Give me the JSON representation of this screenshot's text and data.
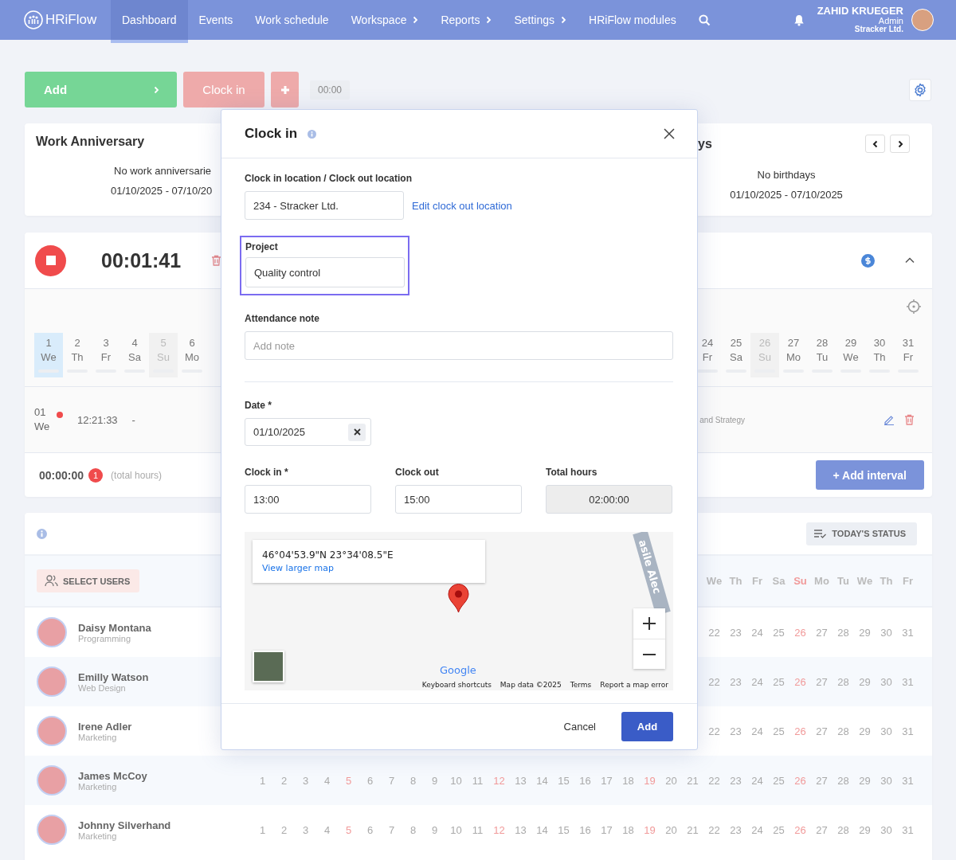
{
  "nav": {
    "brand": "HRiFlow",
    "items": [
      {
        "label": "Dashboard",
        "selected": true,
        "submenu": false
      },
      {
        "label": "Events",
        "selected": false,
        "submenu": false
      },
      {
        "label": "Work schedule",
        "selected": false,
        "submenu": false
      },
      {
        "label": "Workspace",
        "selected": false,
        "submenu": true
      },
      {
        "label": "Reports",
        "selected": false,
        "submenu": true
      },
      {
        "label": "Settings",
        "selected": false,
        "submenu": true
      },
      {
        "label": "HRiFlow modules",
        "selected": false,
        "submenu": false
      }
    ],
    "user": {
      "name": "ZAHID KRUEGER",
      "role": "Admin",
      "company": "Stracker Ltd."
    }
  },
  "actions": {
    "add": "Add",
    "clock_in": "Clock in",
    "timer": "00:00"
  },
  "anniversary": {
    "title": "Work Anniversary",
    "message": "No work anniversarie",
    "range": "01/10/2025 - 07/10/20"
  },
  "birthdays": {
    "title": "ys",
    "message": "No birthdays",
    "range": "01/10/2025 - 07/10/2025"
  },
  "tracker": {
    "elapsed": "00:01:41",
    "days_left": [
      {
        "day": "1",
        "weekday": "We",
        "selected": true,
        "weekend": false
      },
      {
        "day": "2",
        "weekday": "Th",
        "selected": false,
        "weekend": false
      },
      {
        "day": "3",
        "weekday": "Fr",
        "selected": false,
        "weekend": false
      },
      {
        "day": "4",
        "weekday": "Sa",
        "selected": false,
        "weekend": false
      },
      {
        "day": "5",
        "weekday": "Su",
        "selected": false,
        "weekend": true
      },
      {
        "day": "6",
        "weekday": "Mo",
        "selected": false,
        "weekend": false
      }
    ],
    "days_right": [
      {
        "day": "24",
        "weekday": "Fr",
        "selected": false,
        "weekend": false
      },
      {
        "day": "25",
        "weekday": "Sa",
        "selected": false,
        "weekend": false
      },
      {
        "day": "26",
        "weekday": "Su",
        "selected": false,
        "weekend": true
      },
      {
        "day": "27",
        "weekday": "Mo",
        "selected": false,
        "weekend": false
      },
      {
        "day": "28",
        "weekday": "Tu",
        "selected": false,
        "weekend": false
      },
      {
        "day": "29",
        "weekday": "We",
        "selected": false,
        "weekend": false
      },
      {
        "day": "30",
        "weekday": "Th",
        "selected": false,
        "weekend": false
      },
      {
        "day": "31",
        "weekday": "Fr",
        "selected": false,
        "weekend": false
      }
    ],
    "entry": {
      "day": "01",
      "weekday": "We",
      "start": "12:21:33",
      "end": "-",
      "project": "and Strategy"
    },
    "total": "00:00:00",
    "count": "1",
    "total_label": "(total hours)",
    "add_interval": "+ Add interval"
  },
  "schedule": {
    "today_status": "TODAY'S STATUS",
    "select_users": "SELECT USERS",
    "weekdays": [
      {
        "label": "We",
        "sunday": false
      },
      {
        "label": "Th",
        "sunday": false
      },
      {
        "label": "Fr",
        "sunday": false
      },
      {
        "label": "Sa",
        "sunday": false
      },
      {
        "label": "Su",
        "sunday": true
      },
      {
        "label": "Mo",
        "sunday": false
      },
      {
        "label": "Tu",
        "sunday": false
      },
      {
        "label": "We",
        "sunday": false
      },
      {
        "label": "Th",
        "sunday": false
      },
      {
        "label": "Fr",
        "sunday": false
      }
    ],
    "users": [
      {
        "name": "Daisy Montana",
        "team": "Programming",
        "days": [
          {
            "n": "22",
            "sunday": false
          },
          {
            "n": "23",
            "sunday": false
          },
          {
            "n": "24",
            "sunday": false
          },
          {
            "n": "25",
            "sunday": false
          },
          {
            "n": "26",
            "sunday": true
          },
          {
            "n": "27",
            "sunday": false
          },
          {
            "n": "28",
            "sunday": false
          },
          {
            "n": "29",
            "sunday": false
          },
          {
            "n": "30",
            "sunday": false
          },
          {
            "n": "31",
            "sunday": false
          }
        ]
      },
      {
        "name": "Emilly Watson",
        "team": "Web Design",
        "days": [
          {
            "n": "22",
            "sunday": false
          },
          {
            "n": "23",
            "sunday": false
          },
          {
            "n": "24",
            "sunday": false
          },
          {
            "n": "25",
            "sunday": false
          },
          {
            "n": "26",
            "sunday": true
          },
          {
            "n": "27",
            "sunday": false
          },
          {
            "n": "28",
            "sunday": false
          },
          {
            "n": "29",
            "sunday": false
          },
          {
            "n": "30",
            "sunday": false
          },
          {
            "n": "31",
            "sunday": false
          }
        ]
      },
      {
        "name": "Irene Adler",
        "team": "Marketing",
        "days": [
          {
            "n": "22",
            "sunday": false
          },
          {
            "n": "23",
            "sunday": false
          },
          {
            "n": "24",
            "sunday": false
          },
          {
            "n": "25",
            "sunday": false
          },
          {
            "n": "26",
            "sunday": true
          },
          {
            "n": "27",
            "sunday": false
          },
          {
            "n": "28",
            "sunday": false
          },
          {
            "n": "29",
            "sunday": false
          },
          {
            "n": "30",
            "sunday": false
          },
          {
            "n": "31",
            "sunday": false
          }
        ]
      },
      {
        "name": "James McCoy",
        "team": "Marketing",
        "days": [
          {
            "n": "1",
            "sunday": false
          },
          {
            "n": "2",
            "sunday": false
          },
          {
            "n": "3",
            "sunday": false
          },
          {
            "n": "4",
            "sunday": false
          },
          {
            "n": "5",
            "sunday": true
          },
          {
            "n": "6",
            "sunday": false
          },
          {
            "n": "7",
            "sunday": false
          },
          {
            "n": "8",
            "sunday": false
          },
          {
            "n": "9",
            "sunday": false
          },
          {
            "n": "10",
            "sunday": false
          },
          {
            "n": "11",
            "sunday": false
          },
          {
            "n": "12",
            "sunday": true
          },
          {
            "n": "13",
            "sunday": false
          },
          {
            "n": "14",
            "sunday": false
          },
          {
            "n": "15",
            "sunday": false
          },
          {
            "n": "16",
            "sunday": false
          },
          {
            "n": "17",
            "sunday": false
          },
          {
            "n": "18",
            "sunday": false
          },
          {
            "n": "19",
            "sunday": true
          },
          {
            "n": "20",
            "sunday": false
          },
          {
            "n": "21",
            "sunday": false
          },
          {
            "n": "22",
            "sunday": false
          },
          {
            "n": "23",
            "sunday": false
          },
          {
            "n": "24",
            "sunday": false
          },
          {
            "n": "25",
            "sunday": false
          },
          {
            "n": "26",
            "sunday": true
          },
          {
            "n": "27",
            "sunday": false
          },
          {
            "n": "28",
            "sunday": false
          },
          {
            "n": "29",
            "sunday": false
          },
          {
            "n": "30",
            "sunday": false
          },
          {
            "n": "31",
            "sunday": false
          }
        ]
      },
      {
        "name": "Johnny Silverhand",
        "team": "Marketing",
        "days": [
          {
            "n": "1",
            "sunday": false
          },
          {
            "n": "2",
            "sunday": false
          },
          {
            "n": "3",
            "sunday": false
          },
          {
            "n": "4",
            "sunday": false
          },
          {
            "n": "5",
            "sunday": true
          },
          {
            "n": "6",
            "sunday": false
          },
          {
            "n": "7",
            "sunday": false
          },
          {
            "n": "8",
            "sunday": false
          },
          {
            "n": "9",
            "sunday": false
          },
          {
            "n": "10",
            "sunday": false
          },
          {
            "n": "11",
            "sunday": false
          },
          {
            "n": "12",
            "sunday": true
          },
          {
            "n": "13",
            "sunday": false
          },
          {
            "n": "14",
            "sunday": false
          },
          {
            "n": "15",
            "sunday": false
          },
          {
            "n": "16",
            "sunday": false
          },
          {
            "n": "17",
            "sunday": false
          },
          {
            "n": "18",
            "sunday": false
          },
          {
            "n": "19",
            "sunday": true
          },
          {
            "n": "20",
            "sunday": false
          },
          {
            "n": "21",
            "sunday": false
          },
          {
            "n": "22",
            "sunday": false
          },
          {
            "n": "23",
            "sunday": false
          },
          {
            "n": "24",
            "sunday": false
          },
          {
            "n": "25",
            "sunday": false
          },
          {
            "n": "26",
            "sunday": true
          },
          {
            "n": "27",
            "sunday": false
          },
          {
            "n": "28",
            "sunday": false
          },
          {
            "n": "29",
            "sunday": false
          },
          {
            "n": "30",
            "sunday": false
          },
          {
            "n": "31",
            "sunday": false
          }
        ]
      }
    ]
  },
  "modal": {
    "title": "Clock in",
    "location_label": "Clock in location / Clock out location",
    "location": "234 - Stracker Ltd.",
    "edit_link": "Edit clock out location",
    "project_label": "Project",
    "project": "Quality control",
    "project_focused": true,
    "note_label": "Attendance note",
    "note_placeholder": "Add note",
    "date_label": "Date *",
    "date": "01/10/2025",
    "times": [
      {
        "label": "Clock in *",
        "value": "13:00",
        "disabled": false
      },
      {
        "label": "Clock out",
        "value": "15:00",
        "disabled": false
      },
      {
        "label": "Total hours",
        "value": "02:00:00",
        "disabled": true
      }
    ],
    "map": {
      "coords": "46°04'53.9\"N 23°34'08.5\"E",
      "link": "View larger map",
      "road": "asile Alec",
      "logo": "Google",
      "footer": [
        "Keyboard shortcuts",
        "Map data ©2025",
        "Terms",
        "Report a map error"
      ]
    },
    "cancel": "Cancel",
    "submit": "Add"
  }
}
